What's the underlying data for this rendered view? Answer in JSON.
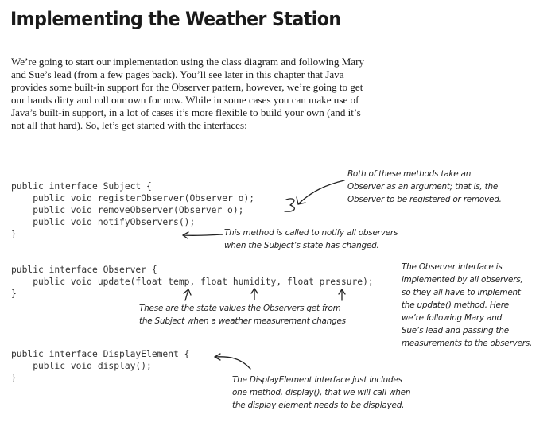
{
  "page": {
    "title": "Implementing the Weather Station",
    "intro_lines": [
      "We’re going to start our implementation using the class diagram and following Mary",
      "and Sue’s lead (from a few pages back).  You’ll see later in this chapter that Java",
      "provides some built-in support for the Observer pattern, however, we’re going to get",
      "our hands dirty and roll our own for now.  While in some cases you can make use of",
      "Java’s built-in support, in a lot of cases it’s more flexible to build your own (and it’s",
      "not all that hard).  So, let’s get started with the interfaces:"
    ]
  },
  "code": {
    "subject": [
      "public interface Subject {",
      "    public void registerObserver(Observer o);",
      "    public void removeObserver(Observer o);",
      "    public void notifyObservers();",
      "}"
    ],
    "observer": [
      "public interface Observer {",
      "    public void update(float temp, float humidity, float pressure);",
      "}"
    ],
    "display": [
      "public interface DisplayElement {",
      "    public void display();",
      "}"
    ]
  },
  "annotations": {
    "methods_args": [
      "Both of these methods take an",
      "Observer as an argument; that is, the",
      "Observer to be registered or removed."
    ],
    "notify": [
      "This method is called to notify all observers",
      "when the Subject’s state has changed."
    ],
    "observer_iface": [
      "The Observer interface is",
      "implemented by all observers,",
      "so they all have to implement",
      "the update() method.  Here",
      "we’re following Mary and",
      "Sue’s lead and passing the",
      "measurements to the observers."
    ],
    "state_values": [
      "These are the state values the Observers get from",
      "the Subject when a weather measurement changes"
    ],
    "display_iface": [
      "The DisplayElement interface just includes",
      "one method, display(), that we will call when",
      "the display element needs to be displayed."
    ]
  }
}
